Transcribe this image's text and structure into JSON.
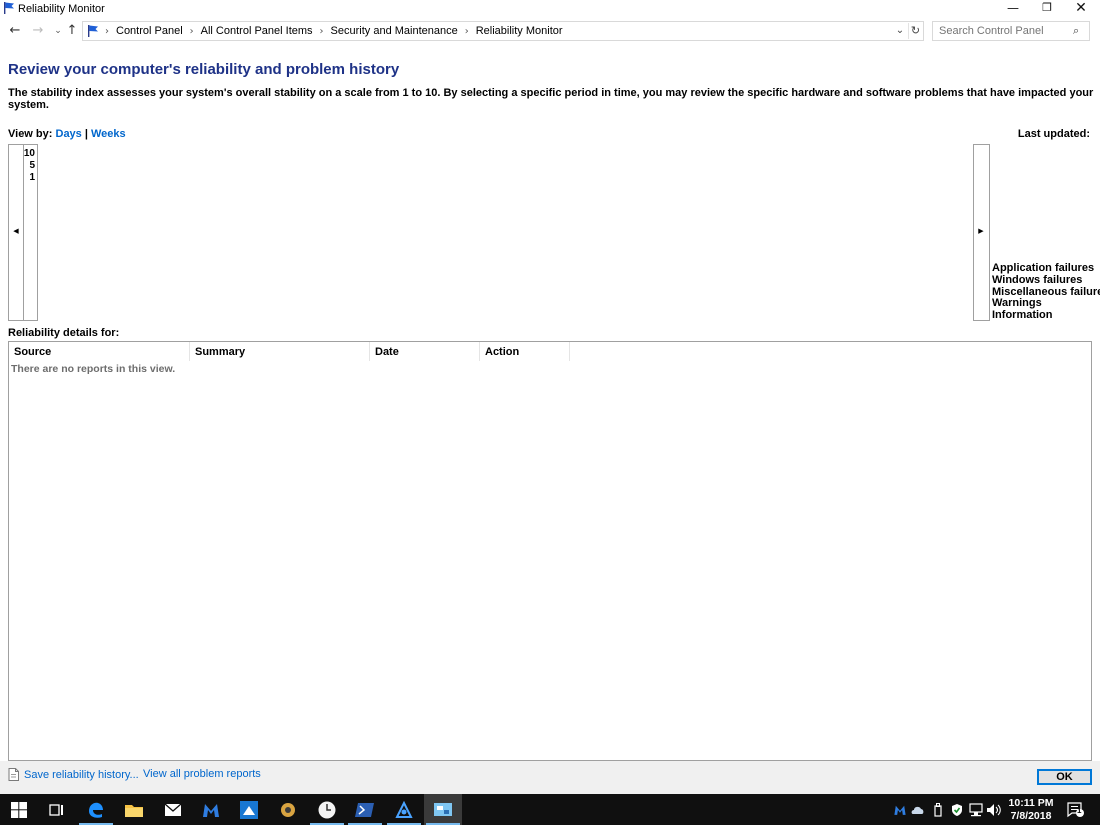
{
  "window": {
    "title": "Reliability Monitor",
    "controls": {
      "minimize": "—",
      "maximize": "❐",
      "close": "✕"
    }
  },
  "nav": {
    "back_icon": "left-arrow-icon",
    "forward_icon": "right-arrow-icon",
    "up_icon": "up-arrow-icon",
    "breadcrumbs": [
      "Control Panel",
      "All Control Panel Items",
      "Security and Maintenance",
      "Reliability Monitor"
    ],
    "search_placeholder": "Search Control Panel"
  },
  "page": {
    "heading": "Review your computer's reliability and problem history",
    "description": "The stability index assesses your system's overall stability on a scale from 1 to 10. By selecting a specific period in time, you may review the specific hardware and software problems that have impacted your system.",
    "view_by_label": "View by:",
    "view_days": "Days",
    "view_separator": "|",
    "view_weeks": "Weeks",
    "last_updated_label": "Last updated:"
  },
  "chart": {
    "y_ticks": [
      "10",
      "5",
      "1"
    ],
    "legend": [
      "Application failures",
      "Windows failures",
      "Miscellaneous failures",
      "Warnings",
      "Information"
    ]
  },
  "details": {
    "label": "Reliability details for:",
    "columns": [
      "Source",
      "Summary",
      "Date",
      "Action"
    ],
    "empty_message": "There are no reports in this view."
  },
  "footer": {
    "save_link": "Save reliability history...",
    "problems_link": "View all problem reports",
    "ok_label": "OK"
  },
  "taskbar": {
    "time": "10:11 PM",
    "date": "7/8/2018",
    "notification_count": "1"
  },
  "colors": {
    "heading": "#1e3287",
    "link": "#0066cc",
    "taskbar": "#101010",
    "accent": "#0078d7"
  }
}
